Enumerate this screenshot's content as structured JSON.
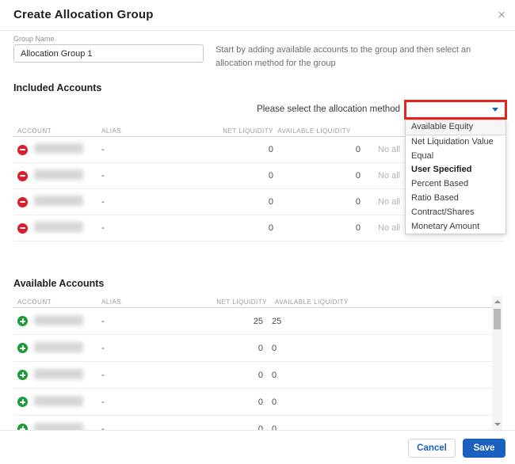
{
  "dialog": {
    "title": "Create Allocation Group",
    "close_glyph": "×"
  },
  "form": {
    "group_name_label": "Group Name",
    "group_name_value": "Allocation Group 1",
    "helper_text": "Start by adding available accounts to the group and then select an allocation method for the group"
  },
  "included": {
    "heading": "Included Accounts",
    "allocation_label": "Please select the allocation method",
    "columns": [
      "ACCOUNT",
      "ALIAS",
      "NET LIQUIDITY",
      "AVAILABLE LIQUIDITY"
    ],
    "rows": [
      {
        "alias": "-",
        "net": "0",
        "available": "0",
        "allocation": "No all"
      },
      {
        "alias": "-",
        "net": "0",
        "available": "0",
        "allocation": "No all"
      },
      {
        "alias": "-",
        "net": "0",
        "available": "0",
        "allocation": "No all"
      },
      {
        "alias": "-",
        "net": "0",
        "available": "0",
        "allocation": "No all"
      }
    ]
  },
  "dropdown": {
    "options": [
      "Available Equity",
      "Net Liquidation Value",
      "Equal",
      "User Specified",
      "Percent Based",
      "Ratio Based",
      "Contract/Shares",
      "Monetary Amount"
    ],
    "bold_option": "User Specified"
  },
  "available": {
    "heading": "Available Accounts",
    "columns": [
      "ACCOUNT",
      "ALIAS",
      "NET LIQUIDITY",
      "AVAILABLE LIQUIDITY"
    ],
    "rows": [
      {
        "alias": "-",
        "net": "25",
        "available": "25"
      },
      {
        "alias": "-",
        "net": "0",
        "available": "0"
      },
      {
        "alias": "-",
        "net": "0",
        "available": "0"
      },
      {
        "alias": "-",
        "net": "0",
        "available": "0"
      },
      {
        "alias": "-",
        "net": "0",
        "available": "0"
      }
    ]
  },
  "footer": {
    "cancel_label": "Cancel",
    "save_label": "Save"
  },
  "colors": {
    "accent_blue": "#1b5fc1",
    "highlight_red": "#e3261d",
    "remove_red": "#d91f2d",
    "add_green": "#1a9c37"
  }
}
